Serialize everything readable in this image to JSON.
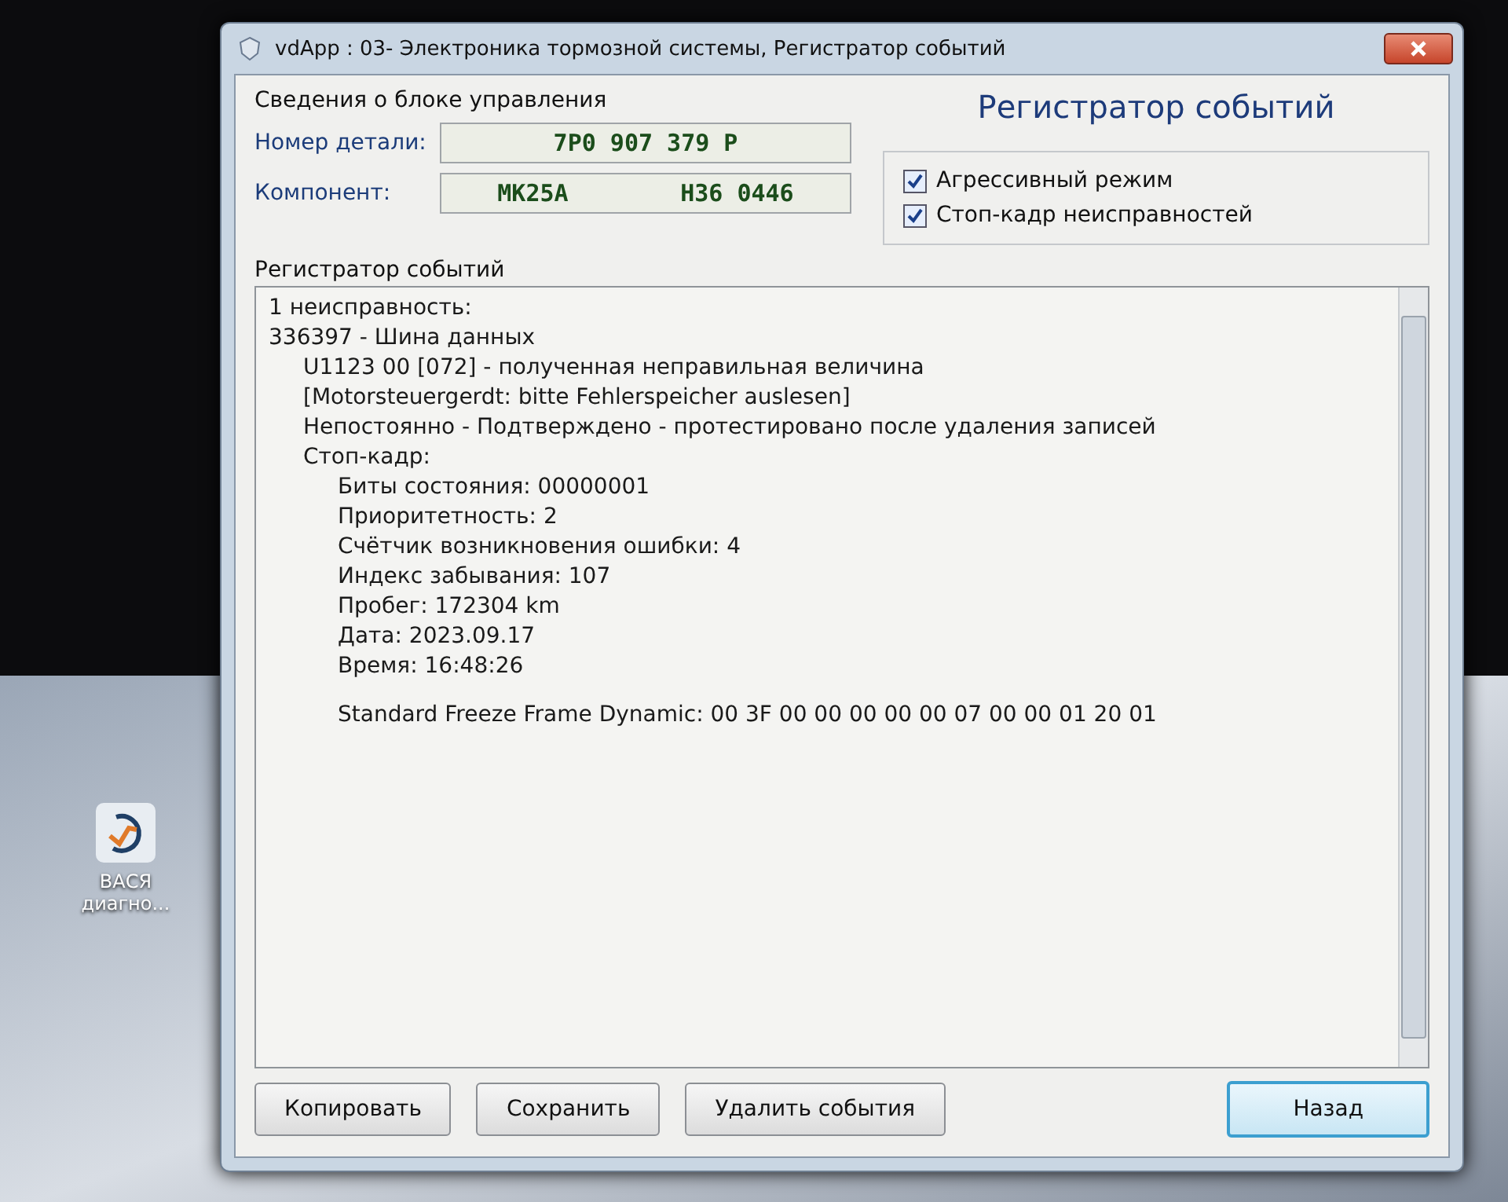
{
  "desktop": {
    "icons": [
      {
        "label": "ВАСЯ диагно..."
      }
    ]
  },
  "window": {
    "title": "vdApp : 03- Электроника тормозной системы,  Регистратор событий"
  },
  "ecu_info": {
    "group_label": "Сведения о блоке управления",
    "fields": [
      {
        "label": "Номер детали:",
        "values": [
          "7P0 907 379 P"
        ]
      },
      {
        "label": "Компонент:",
        "values": [
          "MK25A",
          "H36 0446"
        ]
      }
    ]
  },
  "heading": "Регистратор событий",
  "options": [
    {
      "label": "Агрессивный режим",
      "checked": true
    },
    {
      "label": "Стоп-кадр неисправностей",
      "checked": true
    }
  ],
  "event_log": {
    "group_label": "Регистратор событий",
    "lines": [
      {
        "text": "1 неисправность:"
      },
      {
        "text": "336397 - Шина данных",
        "children": [
          {
            "text": "U1123 00 [072] - полученная неправильная величина"
          },
          {
            "text": "[Motorsteuergerdt: bitte Fehlerspeicher auslesen]"
          },
          {
            "text": "Непостоянно - Подтверждено - протестировано после удаления записей"
          },
          {
            "text": "Стоп-кадр:",
            "children": [
              {
                "text": "Биты состояния: 00000001"
              },
              {
                "text": "Приоритетность: 2"
              },
              {
                "text": "Счётчик возникновения ошибки: 4"
              },
              {
                "text": "Индекс забывания: 107"
              },
              {
                "text": "Пробег: 172304 km"
              },
              {
                "text": "Дата: 2023.09.17"
              },
              {
                "text": "Время: 16:48:26"
              }
            ]
          }
        ]
      }
    ],
    "freeze_frame": "Standard Freeze  Frame Dynamic: 00 3F 00 00 00 00 00 07 00 00 01 20 01"
  },
  "buttons": [
    {
      "label": "Копировать",
      "kind": "normal"
    },
    {
      "label": "Сохранить",
      "kind": "normal"
    },
    {
      "label": "Удалить события",
      "kind": "normal"
    },
    {
      "label": "Назад",
      "kind": "default"
    }
  ]
}
